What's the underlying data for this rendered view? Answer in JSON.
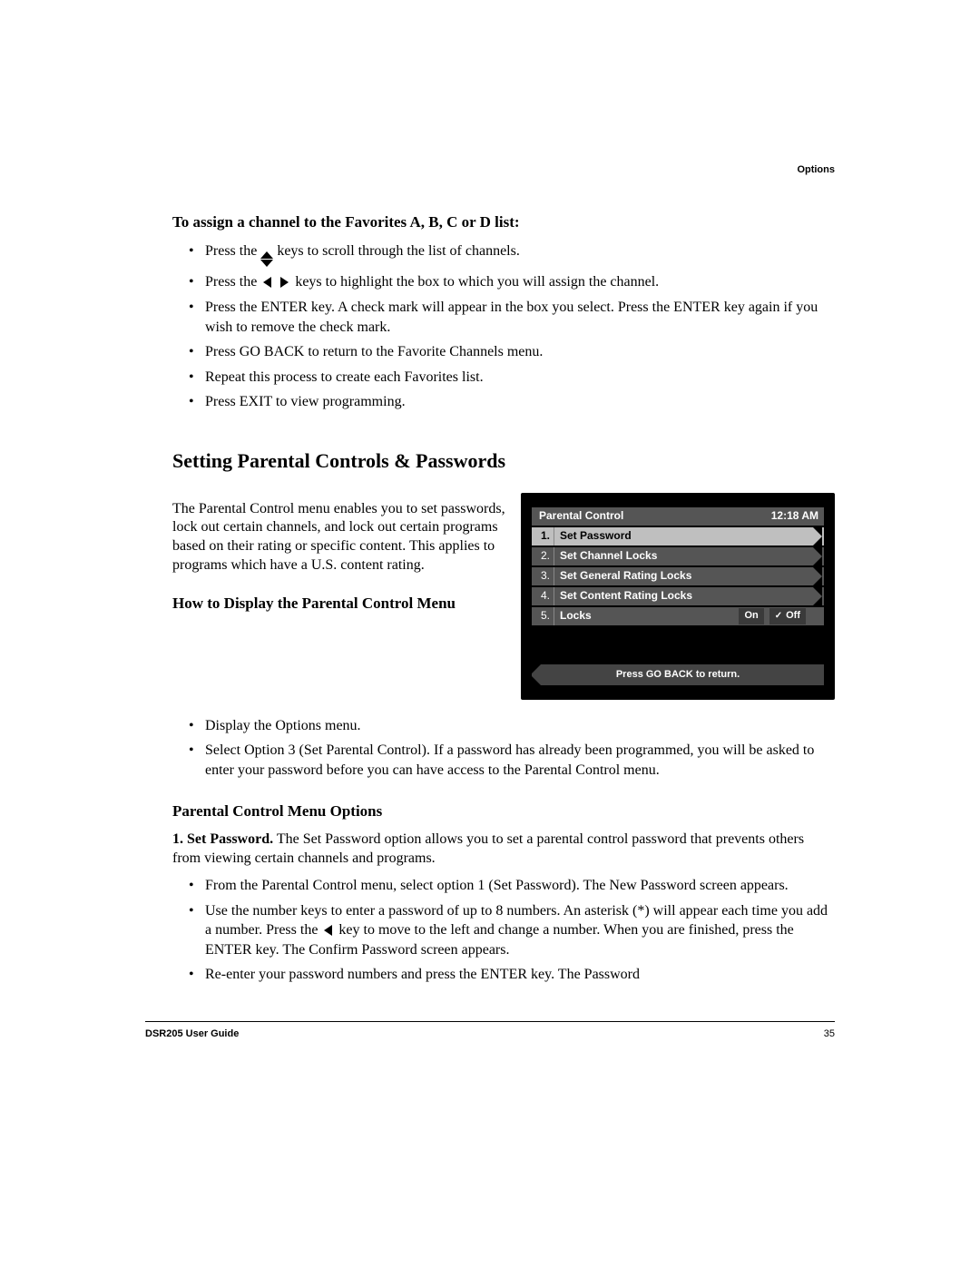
{
  "header": {
    "section": "Options"
  },
  "favorites": {
    "heading": "To assign a channel to the Favorites A, B, C or D list:",
    "b1a": "Press the ",
    "b1b": " keys to scroll through the list of channels.",
    "b2a": "Press the ",
    "b2b": " keys to highlight the box to which you will assign the channel.",
    "b3": "Press the ENTER key. A check mark will appear in the box you select. Press the ENTER key again if you wish to remove the check mark.",
    "b4": "Press GO BACK to return to the Favorite Channels menu.",
    "b5": "Repeat this process to create each Favorites list.",
    "b6": "Press EXIT to view programming."
  },
  "section2": {
    "title": "Setting Parental Controls & Passwords",
    "intro": "The Parental Control menu enables you to set passwords, lock out certain channels, and lock out certain programs based on their rating or specific content. This applies to programs which have a U.S. content rating.",
    "howto_heading": "How to Display the Parental Control Menu",
    "howto_b1": "Display the Options menu.",
    "howto_b2": "Select Option 3 (Set Parental Control). If a password has already been programmed, you will be asked to enter your password before you can have access to the Parental Control menu.",
    "options_heading": "Parental Control Menu Options",
    "opt1_label": "1. Set Password.",
    "opt1_text": " The Set Password option allows you to set a parental control password that prevents others from viewing certain channels and programs.",
    "opt1_b1": "From the Parental Control menu, select option 1 (Set Password). The New Password screen appears.",
    "opt1_b2a": "Use the number keys to enter a password of up to 8 numbers. An asterisk (*) will appear each time you add a number. Press the ",
    "opt1_b2b": " key to move to the left and change a number. When you are finished, press the ENTER key. The Confirm Password screen appears.",
    "opt1_b3": "Re-enter your password numbers and press the ENTER key. The Password"
  },
  "tv": {
    "title": "Parental Control",
    "time": "12:18 AM",
    "rows": [
      {
        "num": "1.",
        "label": "Set Password",
        "selected": true
      },
      {
        "num": "2.",
        "label": "Set Channel Locks",
        "selected": false
      },
      {
        "num": "3.",
        "label": "Set General Rating Locks",
        "selected": false
      },
      {
        "num": "4.",
        "label": "Set Content Rating Locks",
        "selected": false
      }
    ],
    "locks_num": "5.",
    "locks_label": "Locks",
    "on": "On",
    "off": "Off",
    "footer": "Press GO BACK to return."
  },
  "footer": {
    "guide": "DSR205 User Guide",
    "page": "35"
  }
}
